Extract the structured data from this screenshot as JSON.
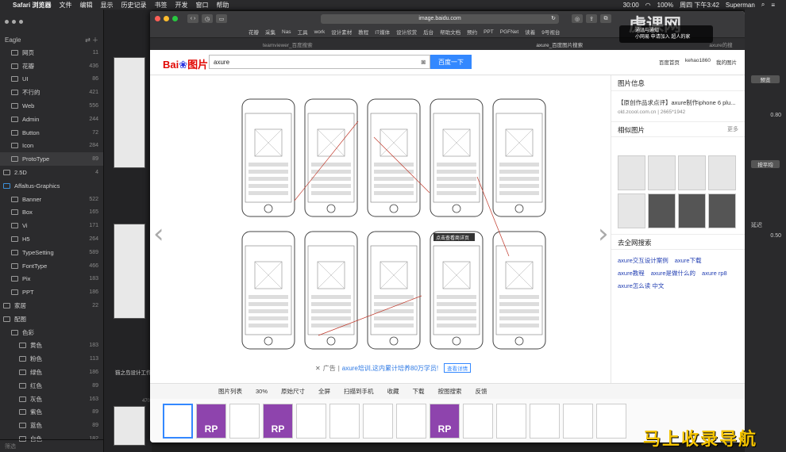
{
  "menubar": {
    "app": "Safari 浏览器",
    "items": [
      "文件",
      "编辑",
      "显示",
      "历史记录",
      "书签",
      "开发",
      "窗口",
      "帮助"
    ],
    "clock": "周四 下午3:42",
    "user": "Superman",
    "battery": "100%",
    "timer": "30:00"
  },
  "eagle": {
    "title": "Eagle",
    "tree": [
      {
        "label": "网页",
        "count": "11",
        "indent": 1
      },
      {
        "label": "花瓣",
        "count": "436",
        "indent": 1
      },
      {
        "label": "UI",
        "count": "86",
        "indent": 1
      },
      {
        "label": "不行的",
        "count": "421",
        "indent": 1
      },
      {
        "label": "Web",
        "count": "556",
        "indent": 1
      },
      {
        "label": "Admin",
        "count": "244",
        "indent": 1
      },
      {
        "label": "Button",
        "count": "72",
        "indent": 1
      },
      {
        "label": "Icon",
        "count": "284",
        "indent": 1
      },
      {
        "label": "ProtoType",
        "count": "89",
        "indent": 1,
        "selected": true
      },
      {
        "label": "2.5D",
        "count": "4",
        "indent": 0
      },
      {
        "label": "Affaltus-Graphics",
        "count": "",
        "indent": 0,
        "open": true
      },
      {
        "label": "Banner",
        "count": "522",
        "indent": 1
      },
      {
        "label": "Box",
        "count": "165",
        "indent": 1
      },
      {
        "label": "Vi",
        "count": "171",
        "indent": 1
      },
      {
        "label": "H5",
        "count": "264",
        "indent": 1
      },
      {
        "label": "TypeSetting",
        "count": "589",
        "indent": 1
      },
      {
        "label": "FontType",
        "count": "466",
        "indent": 1
      },
      {
        "label": "Pix",
        "count": "183",
        "indent": 1
      },
      {
        "label": "PPT",
        "count": "186",
        "indent": 1
      },
      {
        "label": "家居",
        "count": "22",
        "indent": 0
      },
      {
        "label": "配图",
        "count": "",
        "indent": 0
      },
      {
        "label": "色彩",
        "count": "",
        "indent": 1
      },
      {
        "label": "黄色",
        "count": "183",
        "indent": 2
      },
      {
        "label": "粉色",
        "count": "113",
        "indent": 2
      },
      {
        "label": "绿色",
        "count": "186",
        "indent": 2
      },
      {
        "label": "红色",
        "count": "89",
        "indent": 2
      },
      {
        "label": "灰色",
        "count": "163",
        "indent": 2
      },
      {
        "label": "紫色",
        "count": "89",
        "indent": 2
      },
      {
        "label": "蓝色",
        "count": "89",
        "indent": 2
      },
      {
        "label": "白色",
        "count": "182",
        "indent": 2
      }
    ],
    "search_placeholder": "筛选",
    "mid_caption": "猫之岛设计工作",
    "mid_count": "470"
  },
  "safari": {
    "url": "image.baidu.com",
    "favorites": [
      "花瓣",
      "采集",
      "Nas",
      "工具",
      "work",
      "设计素材",
      "教程",
      "IT媒体",
      "设计欣赏",
      "后台",
      "帮助文档",
      "预约",
      "PPT",
      "PGFNet",
      "读着",
      "9号视台"
    ],
    "tabs": [
      "teamviewer_百度搜索",
      "axure_百度图片搜索",
      "axure的搜"
    ]
  },
  "baidu": {
    "logo": "Bai",
    "logo2": "图片",
    "query": "axure",
    "search_button": "百度一下",
    "links": [
      "百度首页",
      "kehao1860",
      "我的图片"
    ],
    "ad_label": "广告",
    "ad_text": "axure培训,这内累计培养80万学员!",
    "ad_button": "查看详情",
    "info_title": "图片信息",
    "info_text": "【原创作品求点评】axure制作iphone 6 plu...",
    "info_source": "old.zcool.com.cn",
    "info_size": "2665*1942",
    "similar_title": "相似图片",
    "similar_more": "更多",
    "search_all_title": "去全网搜索",
    "search_links": [
      "axure交互设计案例",
      "axure下载",
      "axure教程",
      "axure是做什么的",
      "axure rp8",
      "axure怎么读 中文"
    ],
    "toolbar": [
      "图片列表",
      "30%",
      "原始尺寸",
      "全屏",
      "扫描到手机",
      "收藏",
      "下载",
      "按图搜索",
      "反馈"
    ],
    "wire_banner": "点击查看商详页"
  },
  "right_panel": {
    "btn1": "预览",
    "val1": "0.80",
    "btn2": "按平均",
    "label": "延迟",
    "val2": "0.50"
  },
  "notification": {
    "title": "通讯与通知",
    "line": "小网易 申请加入 超人的家"
  },
  "watermark": "马上收录导航",
  "logo_wm": "虎课网"
}
